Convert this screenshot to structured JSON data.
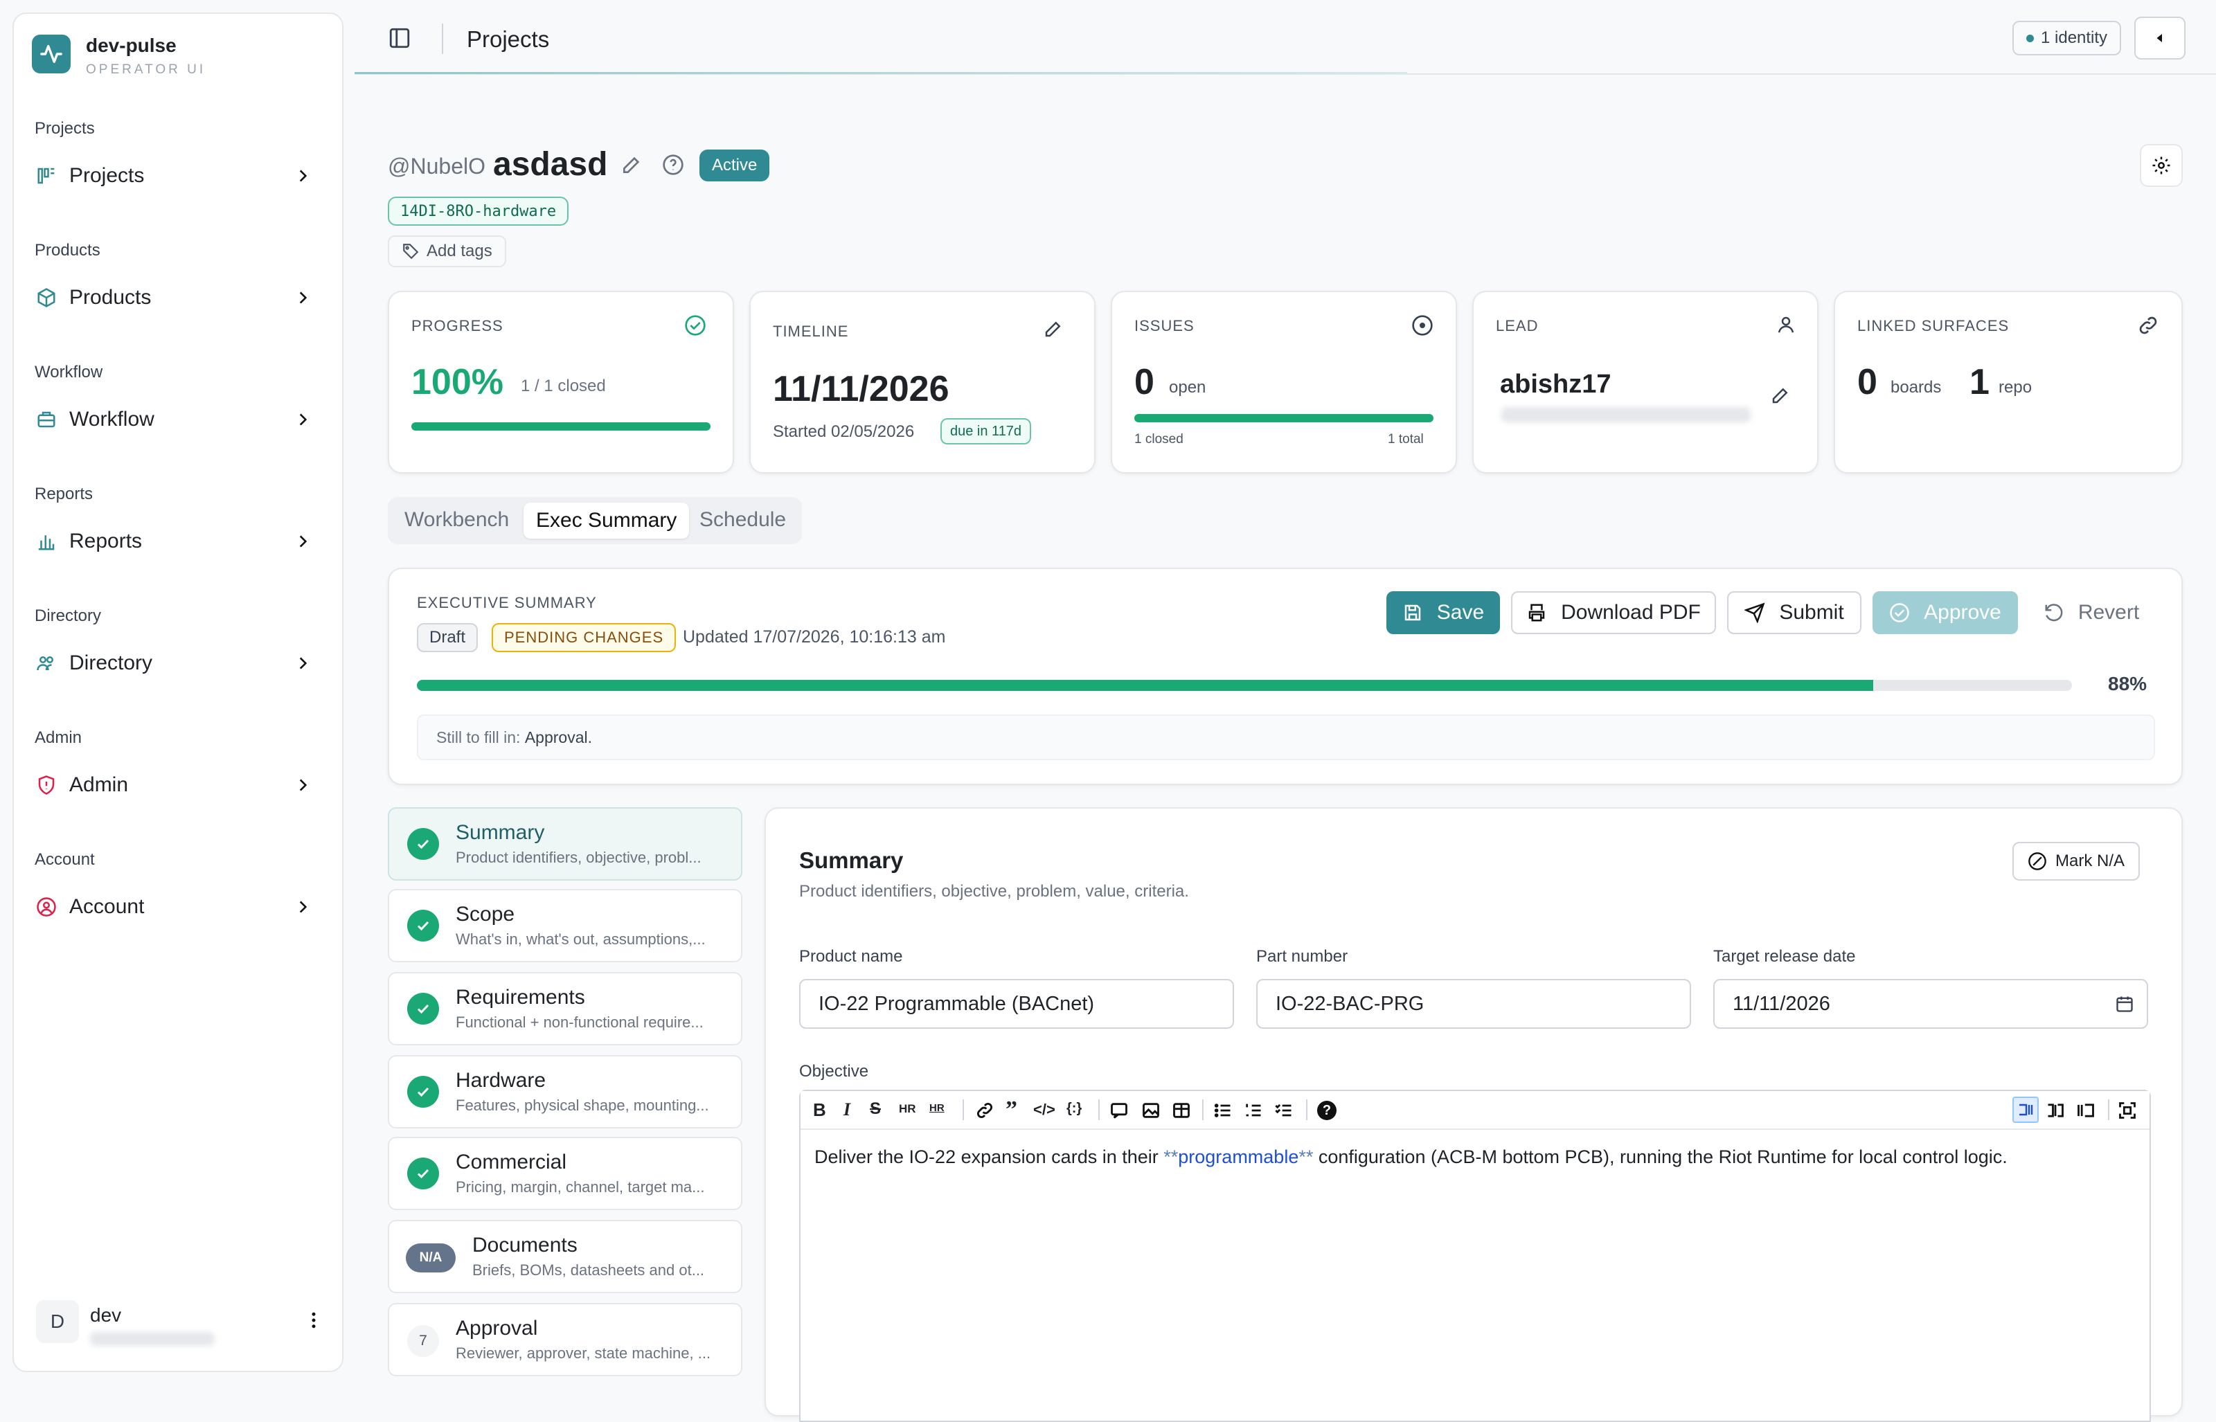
{
  "app": {
    "name": "dev-pulse",
    "subtitle": "OPERATOR UI"
  },
  "sidebar": {
    "groups": [
      {
        "heading": "Projects",
        "item": "Projects"
      },
      {
        "heading": "Products",
        "item": "Products"
      },
      {
        "heading": "Workflow",
        "item": "Workflow"
      },
      {
        "heading": "Reports",
        "item": "Reports"
      },
      {
        "heading": "Directory",
        "item": "Directory"
      },
      {
        "heading": "Admin",
        "item": "Admin"
      },
      {
        "heading": "Account",
        "item": "Account"
      }
    ],
    "user": {
      "initial": "D",
      "name": "dev"
    }
  },
  "header": {
    "title": "Projects",
    "identity": "1 identity"
  },
  "project": {
    "owner": "@NubelO",
    "name": "asdasd",
    "status": "Active",
    "code": "14DI-8RO-hardware",
    "add_tags": "Add tags"
  },
  "stats": {
    "progress": {
      "label": "PROGRESS",
      "value": "100%",
      "sub": "1 / 1 closed",
      "fraction": 1.0
    },
    "timeline": {
      "label": "TIMELINE",
      "date": "11/11/2026",
      "started": "Started 02/05/2026",
      "due": "due in 117d"
    },
    "issues": {
      "label": "ISSUES",
      "count": "0",
      "open": "open",
      "closed": "1 closed",
      "total": "1 total",
      "fraction": 1.0
    },
    "lead": {
      "label": "LEAD",
      "name": "abishz17"
    },
    "linked": {
      "label": "LINKED SURFACES",
      "boards": "0",
      "boards_label": "boards",
      "repos": "1",
      "repos_label": "repo"
    }
  },
  "tabs": [
    "Workbench",
    "Exec Summary",
    "Schedule"
  ],
  "exec": {
    "label": "EXECUTIVE SUMMARY",
    "draft": "Draft",
    "pending": "PENDING CHANGES",
    "updated": "Updated 17/07/2026, 10:16:13 am",
    "save": "Save",
    "download": "Download PDF",
    "submit": "Submit",
    "approve": "Approve",
    "revert": "Revert",
    "percent": "88%",
    "fraction": 0.88,
    "still_prefix": "Still to fill in: ",
    "still_value": "Approval."
  },
  "steps": [
    {
      "title": "Summary",
      "sub": "Product identifiers, objective, probl...",
      "state": "done"
    },
    {
      "title": "Scope",
      "sub": "What's in, what's out, assumptions,...",
      "state": "done"
    },
    {
      "title": "Requirements",
      "sub": "Functional + non-functional require...",
      "state": "done"
    },
    {
      "title": "Hardware",
      "sub": "Features, physical shape, mounting...",
      "state": "done"
    },
    {
      "title": "Commercial",
      "sub": "Pricing, margin, channel, target ma...",
      "state": "done"
    },
    {
      "title": "Documents",
      "sub": "Briefs, BOMs, datasheets and ot...",
      "state": "na",
      "badge": "N/A"
    },
    {
      "title": "Approval",
      "sub": "Reviewer, approver, state machine, ...",
      "state": "todo",
      "badge": "7"
    }
  ],
  "form": {
    "title": "Summary",
    "subtitle": "Product identifiers, objective, problem, value, criteria.",
    "mark_na": "Mark N/A",
    "product_name_label": "Product name",
    "product_name": "IO-22 Programmable (BACnet)",
    "part_number_label": "Part number",
    "part_number": "IO-22-BAC-PRG",
    "release_label": "Target release date",
    "release": "11/11/2026",
    "objective_label": "Objective",
    "objective_pre": "Deliver the IO-22 expansion cards in their ",
    "objective_marks": "**",
    "objective_link": "programmable",
    "objective_post": " configuration (ACB-M bottom PCB), running the Riot Runtime for local control logic."
  }
}
